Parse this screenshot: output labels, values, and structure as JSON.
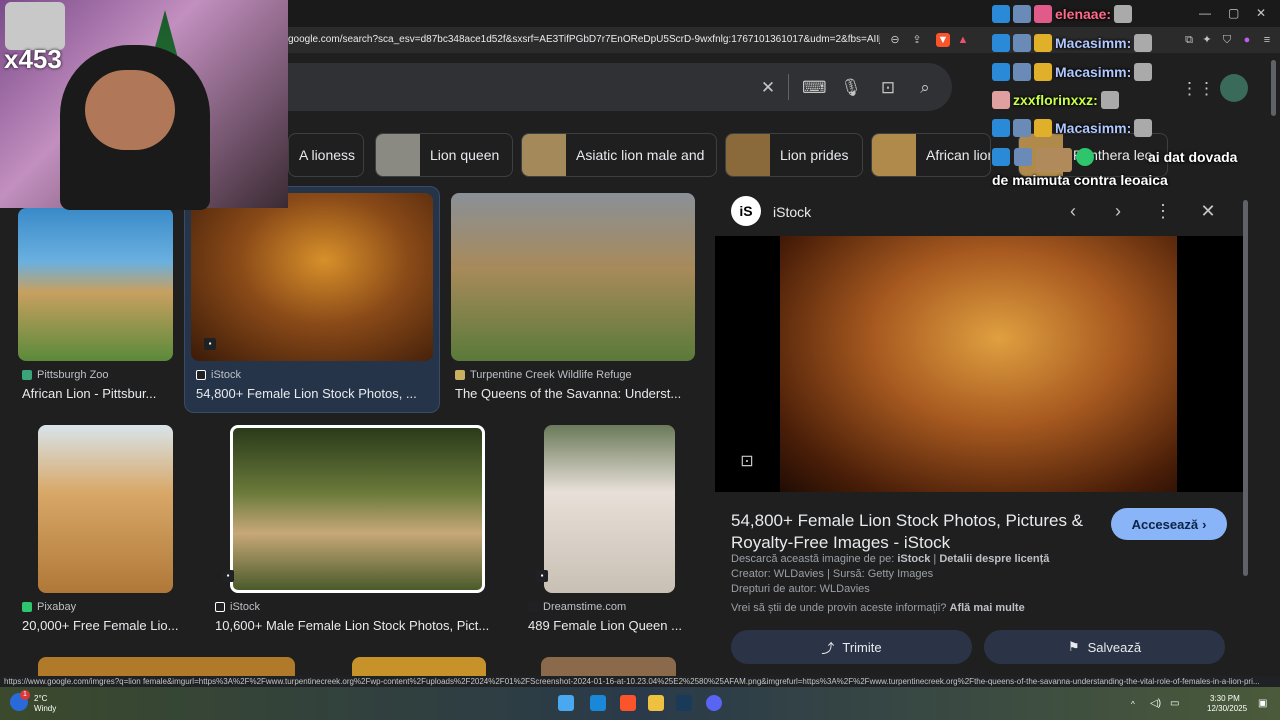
{
  "browser": {
    "url": "google.com/search?sca_esv=d87bc348ace1d52f&sxsrf=AE3TifPGbD7r7EnOReDpU5ScrD-9wxfnlg:1767101361017&udm=2&fbs=AIIjpHxX5k-tO...",
    "status_url": "https://www.google.com/imgres?q=lion female&imgurl=https%3A%2F%2Fwww.turpentinecreek.org%2Fwp-content%2Fuploads%2F2024%2F01%2FScreenshot-2024-01-16-at-10.23.04%25E2%2580%25AFAM.png&imgrefurl=https%3A%2F%2Fwww.turpentinecreek.org%2Fthe-queens-of-the-savanna-understanding-the-vital-role-of-females-in-a-lion-pri..."
  },
  "chips": [
    {
      "label": "A lioness"
    },
    {
      "label": "Lion queen"
    },
    {
      "label": "Asiatic lion male and"
    },
    {
      "label": "Lion prides"
    },
    {
      "label": "African lion"
    },
    {
      "label": "Panthera leo"
    }
  ],
  "results_row1": [
    {
      "source": "Pittsburgh Zoo",
      "title": "African Lion - Pittsbur..."
    },
    {
      "source": "iStock",
      "title": "54,800+ Female Lion Stock Photos, ..."
    },
    {
      "source": "Turpentine Creek Wildlife Refuge",
      "title": "The Queens of the Savanna: Underst..."
    }
  ],
  "results_row2": [
    {
      "source": "Pixabay",
      "title": "20,000+ Free Female Lio..."
    },
    {
      "source": "iStock",
      "title": "10,600+ Male Female Lion Stock Photos, Pict..."
    },
    {
      "source": "Dreamstime.com",
      "title": "489 Female Lion Queen ..."
    }
  ],
  "panel": {
    "site": "iStock",
    "title": "54,800+ Female Lion Stock Photos, Pictures & Royalty-Free Images - iStock",
    "visit_label": "Accesează",
    "download_prefix": "Descarcă această imagine de pe:",
    "download_site": "iStock",
    "license_link": "Detalii despre licență",
    "credit": "Creator: WLDavies | Sursă: Getty Images",
    "copyright": "Drepturi de autor: WLDavies",
    "info_question": "Vrei să știi de unde provin aceste informații?",
    "info_link": "Află mai multe",
    "share_label": "Trimite",
    "save_label": "Salvează"
  },
  "overlay": {
    "counter": "x453",
    "chat": [
      {
        "user": "elenaae:",
        "message": ""
      },
      {
        "user": "Macasimm:",
        "message": ""
      },
      {
        "user": "Macasimm:",
        "message": ""
      },
      {
        "user": "zxxflorinxxz:",
        "message": ""
      },
      {
        "user": "Macasimm:",
        "message": ""
      },
      {
        "user": "",
        "message": "ai dat dovada"
      },
      {
        "user": "",
        "message": "de maimuta contra leoaica"
      }
    ]
  },
  "taskbar": {
    "temperature": "2°C",
    "weather": "Windy",
    "time": "3:30 PM",
    "date": "12/30/2025",
    "notif_count": "1"
  },
  "colors": {
    "accent": "#8ab4f8",
    "background": "#1f1f1f",
    "selected": "#26344a"
  }
}
